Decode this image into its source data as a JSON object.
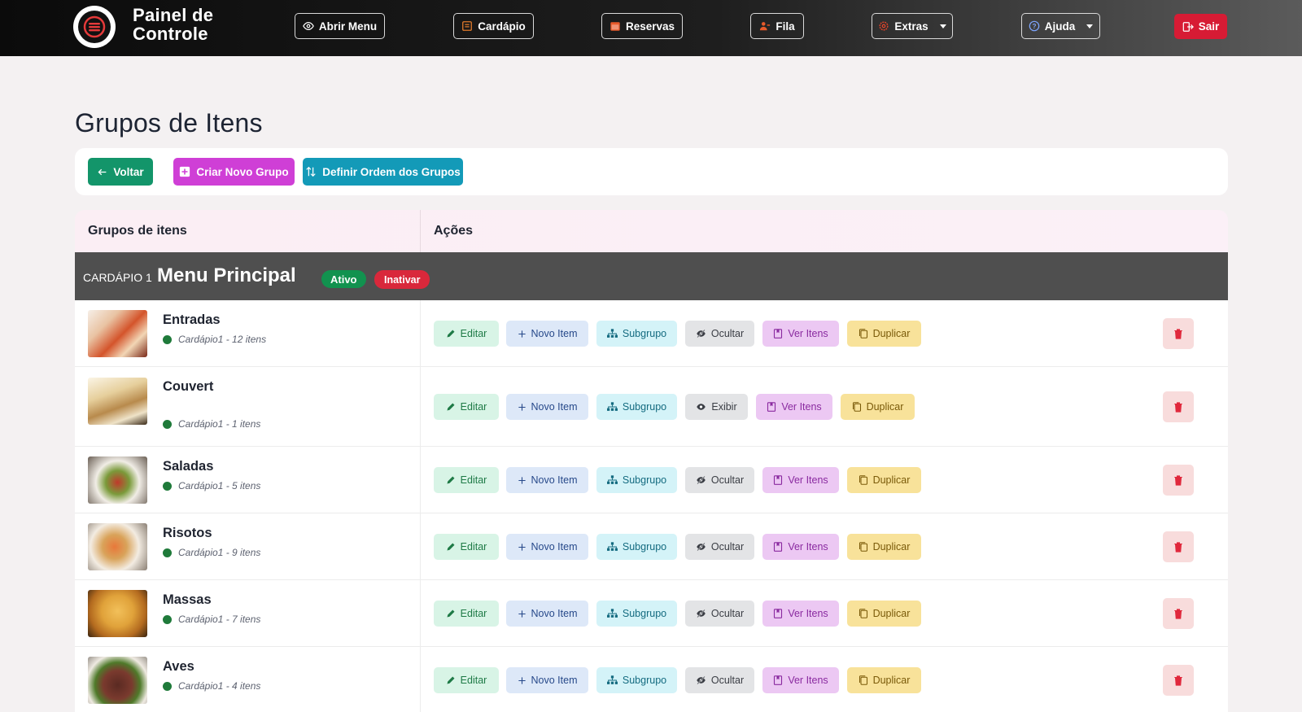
{
  "app": {
    "title_line1": "Painel de",
    "title_line2": "Controle",
    "logo_icon": "menu-plate-icon"
  },
  "nav": {
    "items": [
      {
        "label": "Abrir Menu",
        "icon": "eye-icon"
      },
      {
        "label": "Cardápio",
        "icon": "menu-book-icon"
      },
      {
        "label": "Reservas",
        "icon": "calendar-icon"
      },
      {
        "label": "Fila",
        "icon": "users-icon"
      },
      {
        "label": "Extras",
        "icon": "gear-icon"
      },
      {
        "label": "Ajuda",
        "icon": "question-icon"
      }
    ],
    "logout_label": "Sair"
  },
  "page": {
    "title": "Grupos de Itens"
  },
  "actions": {
    "back_label": "Voltar",
    "create_label": "Criar Novo Grupo",
    "order_label": "Definir Ordem dos Grupos"
  },
  "table": {
    "col_groups": "Grupos de itens",
    "col_actions": "Ações",
    "menu": {
      "label": "CARDÁPIO 1",
      "name": "Menu Principal",
      "status": "Ativo",
      "toggle_label": "Inativar"
    },
    "action_labels": {
      "edit": "Editar",
      "new_item": "Novo Item",
      "subgroup": "Subgrupo",
      "hide": "Ocultar",
      "show": "Exibir",
      "view_items": "Ver Itens",
      "duplicate": "Duplicar"
    },
    "rows": [
      {
        "name": "Entradas",
        "meta": "Cardápio1 - 12 itens",
        "visibility_label": "Ocultar"
      },
      {
        "name": "Couvert",
        "meta": "Cardápio1 - 1 itens",
        "visibility_label": "Exibir"
      },
      {
        "name": "Saladas",
        "meta": "Cardápio1 - 5 itens",
        "visibility_label": "Ocultar"
      },
      {
        "name": "Risotos",
        "meta": "Cardápio1 - 9 itens",
        "visibility_label": "Ocultar"
      },
      {
        "name": "Massas",
        "meta": "Cardápio1 - 7 itens",
        "visibility_label": "Ocultar"
      },
      {
        "name": "Aves",
        "meta": "Cardápio1 - 4 itens",
        "visibility_label": "Ocultar"
      }
    ]
  },
  "colors": {
    "voltar": "#13956a",
    "criar": "#cf3fd6",
    "definir": "#139ab8",
    "sair": "#d71b34",
    "ativo": "#12924f",
    "inativar": "#d9283b"
  }
}
